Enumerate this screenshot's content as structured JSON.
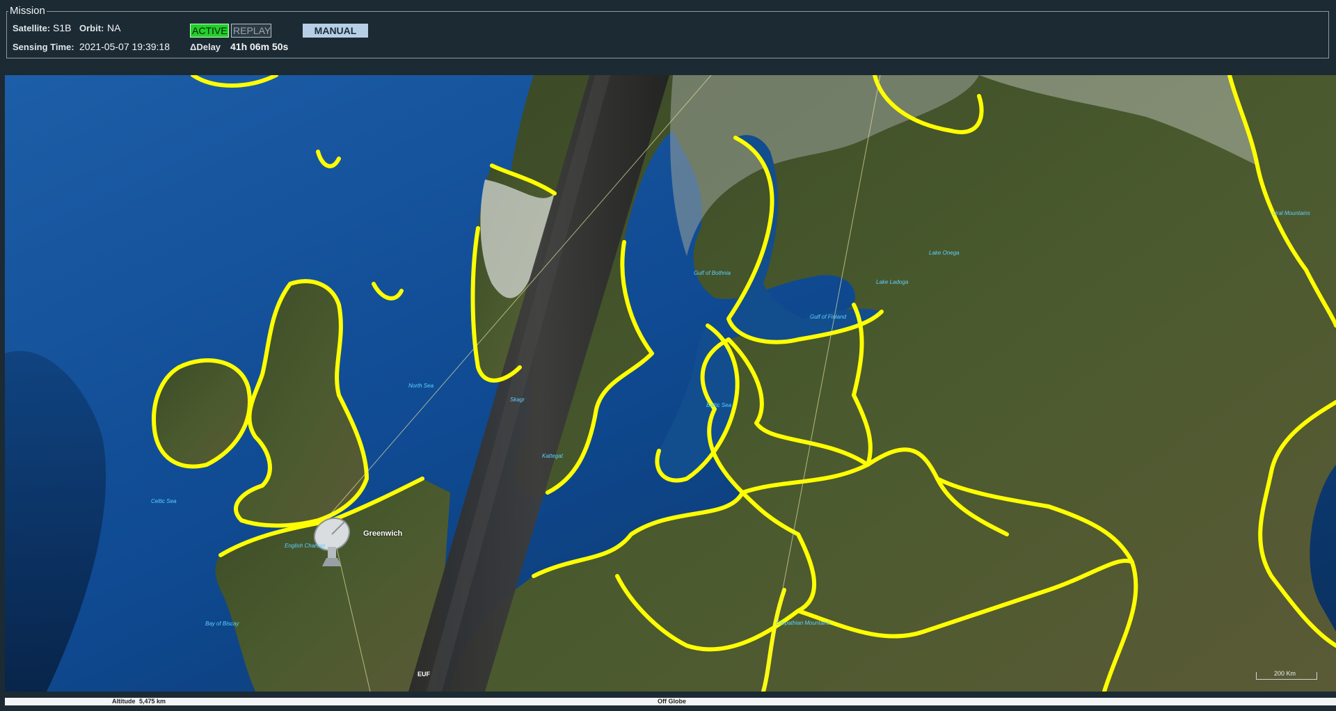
{
  "mission": {
    "title": "Mission",
    "satellite_label": "Satellite:",
    "satellite_value": "S1B",
    "orbit_label": "Orbit:",
    "orbit_value": "NA",
    "sensing_label": "Sensing Time:",
    "sensing_value": "2021-05-07 19:39:18",
    "delay_label": "ΔDelay",
    "delay_value": "41h 06m 50s",
    "mode_active": "ACTIVE",
    "mode_replay": "REPLAY",
    "manual_button": "MANUAL"
  },
  "map": {
    "ground_station": "Greenwich",
    "swath_label": "EUF",
    "scale_label": "200 Km",
    "places": [
      {
        "name": "North Sea"
      },
      {
        "name": "Celtic Sea"
      },
      {
        "name": "English Channel"
      },
      {
        "name": "Bay of Biscay"
      },
      {
        "name": "Skagr"
      },
      {
        "name": "Kattegat"
      },
      {
        "name": "Gulf of Bothnia"
      },
      {
        "name": "Gulf of Finland"
      },
      {
        "name": "Baltic Sea"
      },
      {
        "name": "Lake Onega"
      },
      {
        "name": "Lake Ladoga"
      },
      {
        "name": "Ural Mountains"
      },
      {
        "name": "Carpathian Mountains"
      }
    ]
  },
  "status": {
    "altitude_label": "Altitude",
    "altitude_value": "5,475 km",
    "globe_state": "Off Globe"
  },
  "colors": {
    "active": "#22d02a",
    "border": "#ffff00",
    "manual": "#b7cfe6"
  }
}
